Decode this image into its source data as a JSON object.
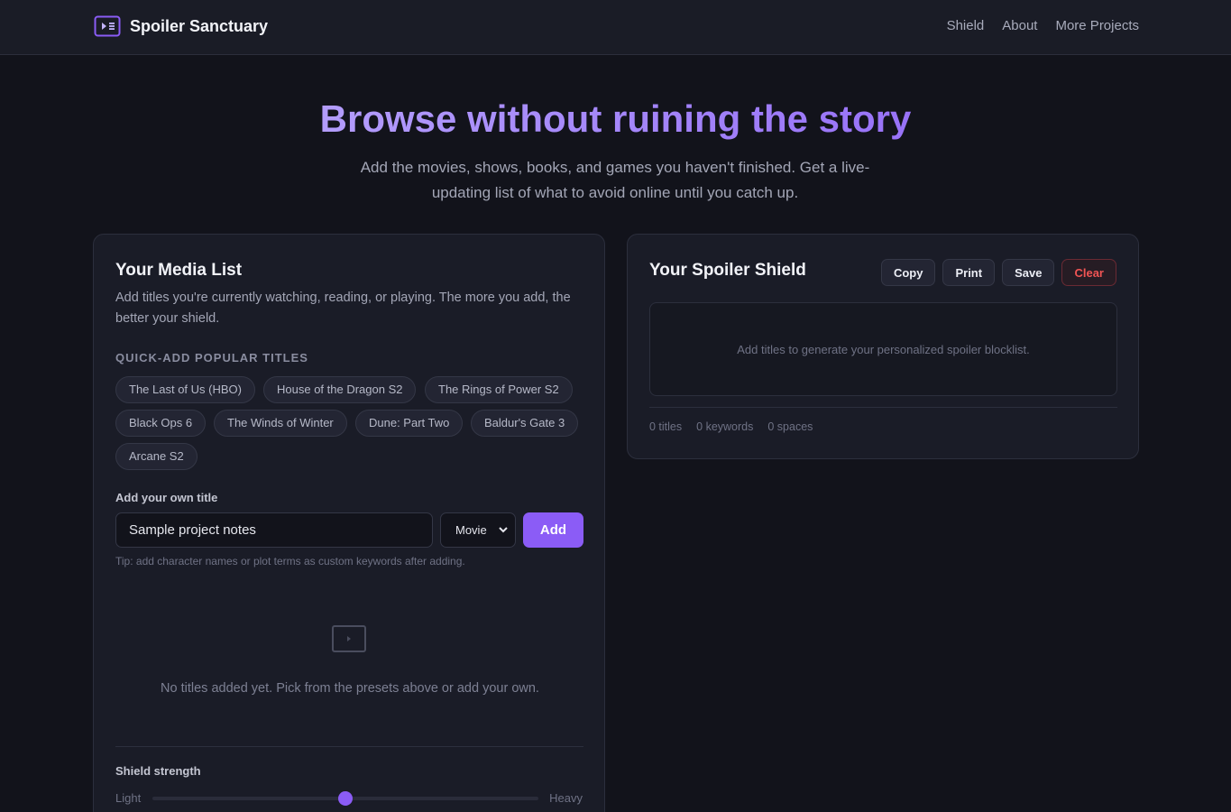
{
  "header": {
    "brand": "Spoiler Sanctuary",
    "nav": [
      "Shield",
      "About",
      "More Projects"
    ]
  },
  "hero": {
    "title": "Browse without ruining the story",
    "subtitle": "Add the movies, shows, books, and games you haven't finished. Get a live-updating list of what to avoid online until you catch up."
  },
  "media": {
    "title": "Your Media List",
    "description": "Add titles you're currently watching, reading, or playing. The more you add, the better your shield.",
    "quick_add_label": "QUICK-ADD POPULAR TITLES",
    "presets": [
      "The Last of Us (HBO)",
      "House of the Dragon S2",
      "The Rings of Power S2",
      "Black Ops 6",
      "The Winds of Winter",
      "Dune: Part Two",
      "Baldur's Gate 3",
      "Arcane S2"
    ],
    "own_title_label": "Add your own title",
    "input_value": "Sample project notes",
    "type_selected": "Movie",
    "add_label": "Add",
    "tip": "Tip: add character names or plot terms as custom keywords after adding.",
    "empty_text": "No titles added yet. Pick from the presets above or add your own.",
    "strength_label": "Shield strength",
    "strength_low": "Light",
    "strength_high": "Heavy",
    "strength_value": 0.5
  },
  "shield": {
    "title": "Your Spoiler Shield",
    "buttons": {
      "copy": "Copy",
      "print": "Print",
      "save": "Save",
      "clear": "Clear"
    },
    "placeholder": "Add titles to generate your personalized spoiler blocklist.",
    "stats": {
      "titles": "0 titles",
      "keywords": "0 keywords",
      "spaces": "0 spaces"
    }
  },
  "colors": {
    "accent": "#8b5cf6",
    "danger": "#f05454",
    "background": "#12131b",
    "card": "#1a1c27"
  },
  "icons": {
    "brand": "video-list-icon",
    "empty": "play-screen-icon",
    "select": "chevron-down-icon"
  }
}
